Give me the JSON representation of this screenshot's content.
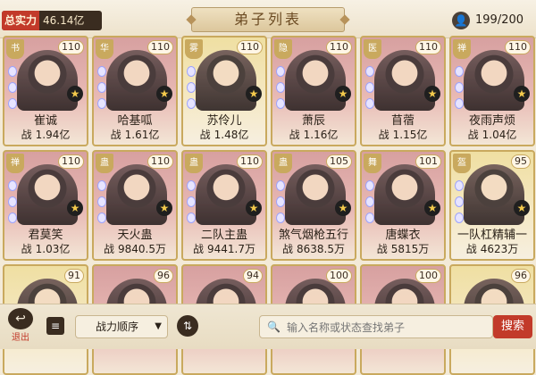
{
  "header": {
    "power_label": "总实力",
    "power_value": "46.14亿",
    "title": "弟子列表",
    "count": "199/200"
  },
  "cards": [
    {
      "badge": "书",
      "level": "110",
      "name": "崔诚",
      "stat_label": "战",
      "stat": "1.94亿"
    },
    {
      "badge": "华",
      "level": "110",
      "name": "哈基呱",
      "stat_label": "战",
      "stat": "1.61亿"
    },
    {
      "badge": "雾",
      "level": "110",
      "name": "苏伶儿",
      "stat_label": "战",
      "stat": "1.48亿"
    },
    {
      "badge": "隐",
      "level": "110",
      "name": "萧辰",
      "stat_label": "战",
      "stat": "1.16亿"
    },
    {
      "badge": "医",
      "level": "110",
      "name": "苜蓿",
      "stat_label": "战",
      "stat": "1.15亿"
    },
    {
      "badge": "禅",
      "level": "110",
      "name": "夜雨声烦",
      "stat_label": "战",
      "stat": "1.04亿"
    },
    {
      "badge": "禅",
      "level": "110",
      "name": "君莫笑",
      "stat_label": "战",
      "stat": "1.03亿"
    },
    {
      "badge": "蛊",
      "level": "110",
      "name": "天火蛊",
      "stat_label": "战",
      "stat": "9840.5万"
    },
    {
      "badge": "蛊",
      "level": "110",
      "name": "二队主蛊",
      "stat_label": "战",
      "stat": "9441.7万"
    },
    {
      "badge": "蛊",
      "level": "105",
      "name": "煞气烟枪五行",
      "stat_label": "战",
      "stat": "8638.5万"
    },
    {
      "badge": "舞",
      "level": "101",
      "name": "唐蝶衣",
      "stat_label": "战",
      "stat": "5815万"
    },
    {
      "badge": "盔",
      "level": "95",
      "name": "一队杠精辅一",
      "stat_label": "战",
      "stat": "4623万"
    },
    {
      "badge": "",
      "level": "91"
    },
    {
      "badge": "",
      "level": "96"
    },
    {
      "badge": "",
      "level": "94"
    },
    {
      "badge": "",
      "level": "100"
    },
    {
      "badge": "",
      "level": "100"
    },
    {
      "badge": "",
      "level": "96"
    }
  ],
  "bottom": {
    "exit_label": "退出",
    "sort_label": "战力顺序",
    "search_placeholder": "输入名称或状态查找弟子",
    "search_button": "搜索"
  },
  "icons": {
    "star": "★",
    "person": "👤",
    "filter": "≡",
    "swap": "⇅",
    "search": "🔍",
    "chevron": "▼",
    "exit": "↩"
  }
}
